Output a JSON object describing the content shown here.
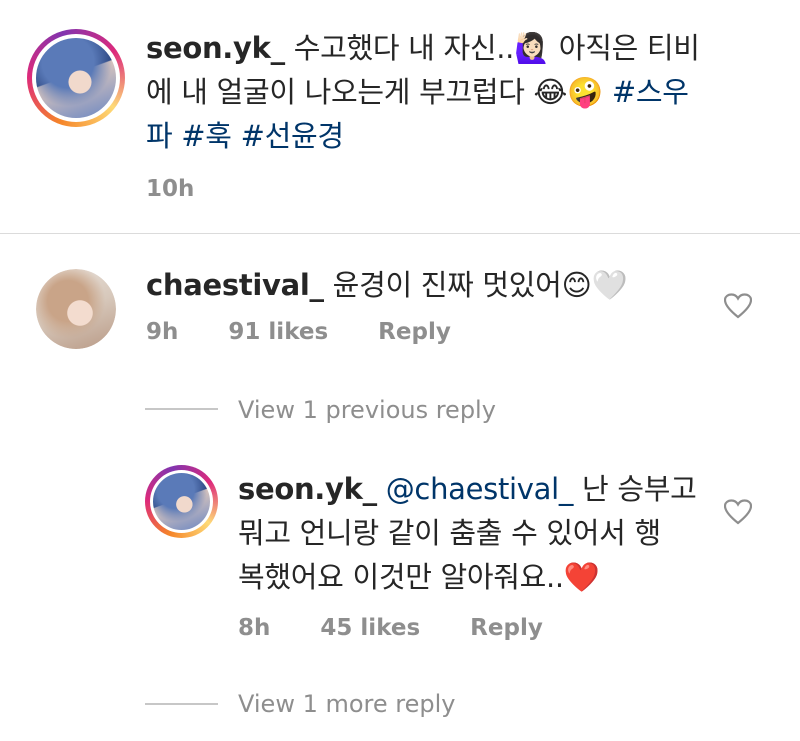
{
  "caption": {
    "username": "seon.yk_",
    "text_part1": " 수고했다 내 자신..",
    "emoji1": "🙋🏻‍♀️",
    "text_part2": " 아직은 티비",
    "line2_text": "에 내 얼굴이 나오는게 부끄럽다 ",
    "emoji2": "😂🤪",
    "hashtag1": " #스우",
    "line3_hashtag1_cont": "파",
    "hashtag2": " #훅",
    "hashtag3": " #선윤경",
    "time": "10h"
  },
  "comment1": {
    "username": "chaestival_",
    "text": " 윤경이 진짜 멋있어",
    "emoji": "😊🤍",
    "time": "9h",
    "likes": "91 likes",
    "reply_label": "Reply"
  },
  "view_previous": "View 1 previous reply",
  "reply1": {
    "username": "seon.yk_",
    "mention": " @chaestival_",
    "line1_text": " 난 승부고",
    "line2_text": "뭐고 언니랑 같이 춤출 수 있어서 행",
    "line3_text": "복했어요 이것만 알아줘요..",
    "emoji": "❤️",
    "time": "8h",
    "likes": "45 likes",
    "reply_label": "Reply"
  },
  "view_more": "View 1 more reply",
  "icons": {
    "heart": "heart-outline-icon"
  },
  "colors": {
    "text": "#262626",
    "muted": "#8e8e8e",
    "link": "#003569"
  }
}
